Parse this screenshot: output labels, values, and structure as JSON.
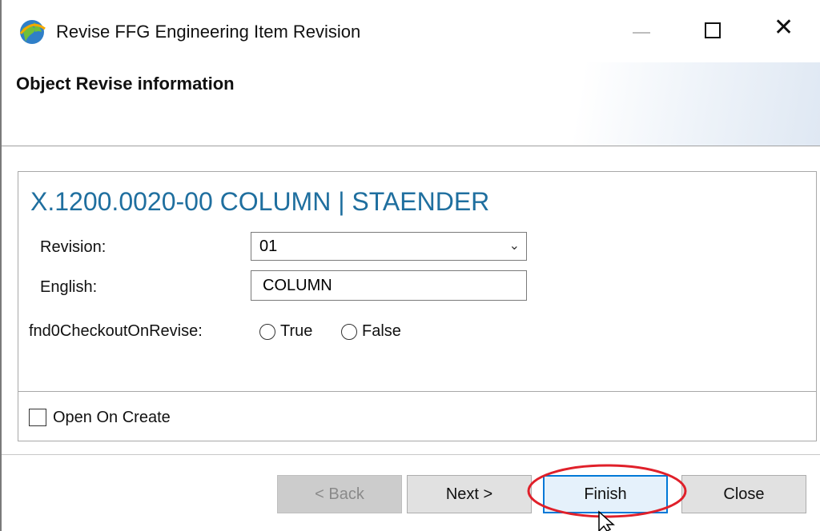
{
  "window": {
    "title": "Revise FFG Engineering Item Revision"
  },
  "header": {
    "title": "Object Revise information"
  },
  "object": {
    "title": "X.1200.0020-00 COLUMN | STAENDER"
  },
  "form": {
    "revision_label": "Revision:",
    "revision_value": "01",
    "english_label": "English:",
    "english_value": "COLUMN",
    "checkout_label": "fnd0CheckoutOnRevise:",
    "checkout_options": [
      "True",
      "False"
    ]
  },
  "options": {
    "open_on_create": "Open On Create"
  },
  "buttons": {
    "back": "< Back",
    "next": "Next >",
    "finish": "Finish",
    "close": "Close"
  },
  "colors": {
    "object_title": "#1f6f9f",
    "annotation": "#e0202a",
    "default_button_border": "#0078d7"
  }
}
